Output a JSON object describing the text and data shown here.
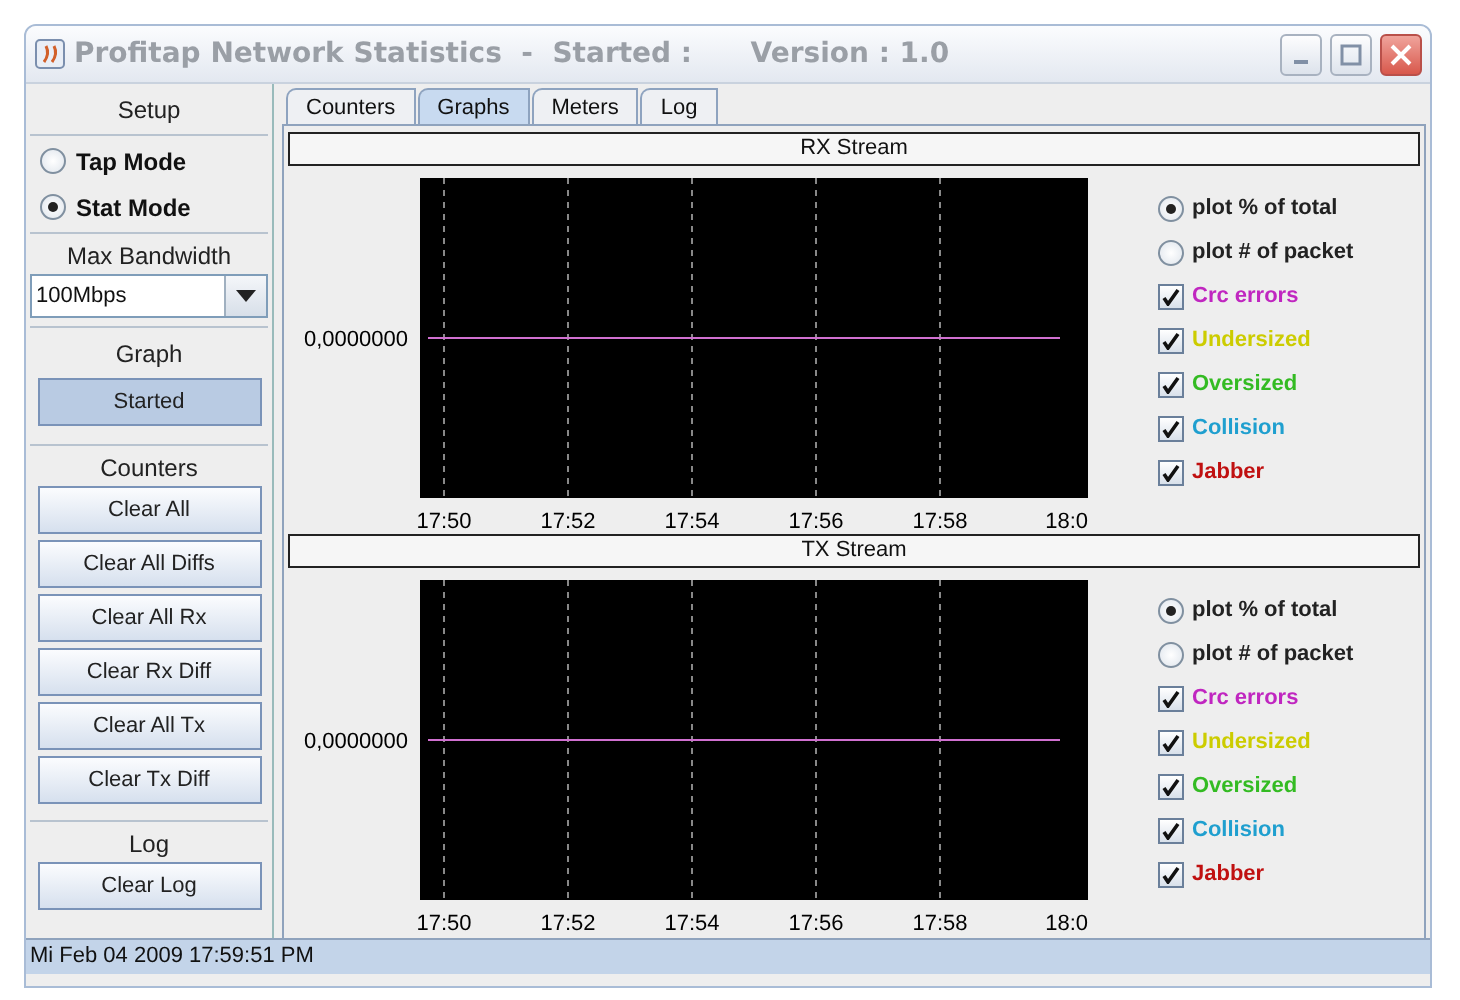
{
  "window": {
    "title": "Profitap Network Statistics  -  Started :      Version : 1.0"
  },
  "sidebar": {
    "setup_label": "Setup",
    "modes": [
      {
        "label": "Tap Mode",
        "selected": false
      },
      {
        "label": "Stat Mode",
        "selected": true
      }
    ],
    "bandwidth_label": "Max Bandwidth",
    "bandwidth": {
      "value": "100Mbps"
    },
    "graph_label": "Graph",
    "graph_button": {
      "label": "Started",
      "pressed": true
    },
    "counters_label": "Counters",
    "counter_buttons": [
      "Clear All",
      "Clear All Diffs",
      "Clear All Rx",
      "Clear Rx Diff",
      "Clear All Tx",
      "Clear Tx Diff"
    ],
    "log_label": "Log",
    "log_button": "Clear Log"
  },
  "tabs": [
    {
      "label": "Counters",
      "selected": false
    },
    {
      "label": "Graphs",
      "selected": true
    },
    {
      "label": "Meters",
      "selected": false
    },
    {
      "label": "Log",
      "selected": false
    }
  ],
  "streams": [
    {
      "title": "RX Stream",
      "y_tick": "0,0000000",
      "x_ticks": [
        "17:50",
        "17:52",
        "17:54",
        "17:56",
        "17:58",
        "18:0"
      ],
      "legend": [
        {
          "kind": "radio",
          "label": "plot % of total",
          "selected": true
        },
        {
          "kind": "radio",
          "label": "plot # of packet",
          "selected": false
        },
        {
          "kind": "checkbox",
          "label": "Crc errors",
          "checked": true,
          "color": "#c026c0"
        },
        {
          "kind": "checkbox",
          "label": "Undersized",
          "checked": true,
          "color": "#cccc00"
        },
        {
          "kind": "checkbox",
          "label": "Oversized",
          "checked": true,
          "color": "#33bb22"
        },
        {
          "kind": "checkbox",
          "label": "Collision",
          "checked": true,
          "color": "#1f9fcf"
        },
        {
          "kind": "checkbox",
          "label": "Jabber",
          "checked": true,
          "color": "#c01010"
        }
      ]
    },
    {
      "title": "TX Stream",
      "y_tick": "0,0000000",
      "x_ticks": [
        "17:50",
        "17:52",
        "17:54",
        "17:56",
        "17:58",
        "18:0"
      ],
      "legend": [
        {
          "kind": "radio",
          "label": "plot % of total",
          "selected": true
        },
        {
          "kind": "radio",
          "label": "plot # of packet",
          "selected": false
        },
        {
          "kind": "checkbox",
          "label": "Crc errors",
          "checked": true,
          "color": "#c026c0"
        },
        {
          "kind": "checkbox",
          "label": "Undersized",
          "checked": true,
          "color": "#cccc00"
        },
        {
          "kind": "checkbox",
          "label": "Oversized",
          "checked": true,
          "color": "#33bb22"
        },
        {
          "kind": "checkbox",
          "label": "Collision",
          "checked": true,
          "color": "#1f9fcf"
        },
        {
          "kind": "checkbox",
          "label": "Jabber",
          "checked": true,
          "color": "#c01010"
        }
      ]
    }
  ],
  "status_bar": "Mi Feb 04 2009 17:59:51 PM"
}
